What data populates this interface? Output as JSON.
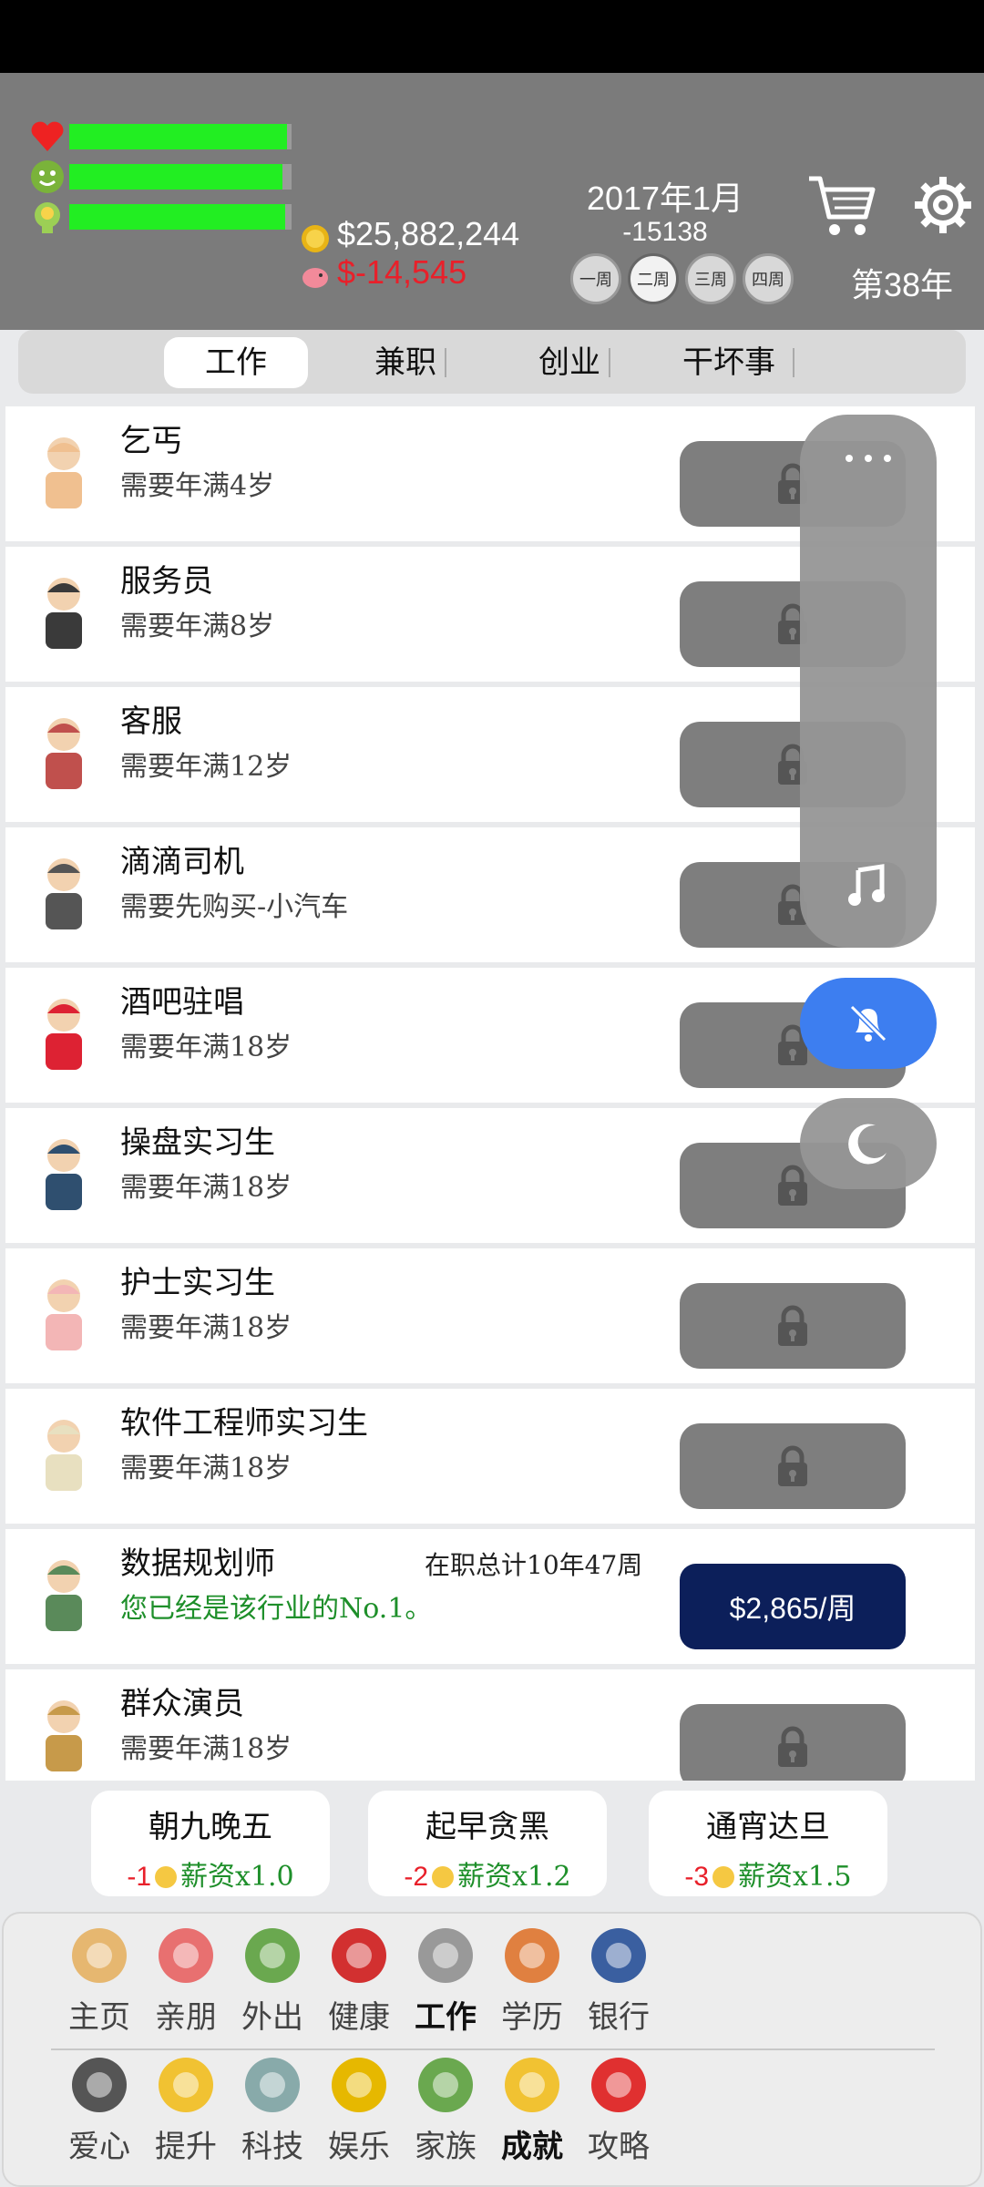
{
  "stats": {
    "health_level": 0.98,
    "mood_level": 0.96,
    "smart_level": 0.97,
    "cash": "$25,882,244",
    "debt": "$-14,545"
  },
  "calendar": {
    "date": "2017年1月",
    "day_number": "-15138",
    "weeks": [
      "一周",
      "二周",
      "三周",
      "四周"
    ],
    "active_week": 1,
    "year_label": "第38年"
  },
  "tabs": [
    "工作",
    "兼职",
    "创业",
    "干坏事"
  ],
  "jobs": [
    {
      "title": "乞丐",
      "req": "需要年满4岁",
      "locked": true
    },
    {
      "title": "服务员",
      "req": "需要年满8岁",
      "locked": true
    },
    {
      "title": "客服",
      "req": "需要年满12岁",
      "locked": true
    },
    {
      "title": "滴滴司机",
      "req": "需要先购买-小汽车",
      "locked": true
    },
    {
      "title": "酒吧驻唱",
      "req": "需要年满18岁",
      "locked": true
    },
    {
      "title": "操盘实习生",
      "req": "需要年满18岁",
      "locked": true
    },
    {
      "title": "护士实习生",
      "req": "需要年满18岁",
      "locked": true
    },
    {
      "title": "软件工程师实习生",
      "req": "需要年满18岁",
      "locked": true
    },
    {
      "title": "数据规划师",
      "req": "您已经是该行业的No.1。",
      "total": "在职总计10年47周",
      "pay": "$2,865/周",
      "locked": false
    },
    {
      "title": "群众演员",
      "req": "需要年满18岁",
      "locked": true
    }
  ],
  "modes": [
    {
      "title": "朝九晚五",
      "mood": "-1",
      "salary": "薪资x1.0"
    },
    {
      "title": "起早贪黑",
      "mood": "-2",
      "salary": "薪资x1.2"
    },
    {
      "title": "通宵达旦",
      "mood": "-3",
      "salary": "薪资x1.5"
    }
  ],
  "nav_row1": [
    "主页",
    "亲朋",
    "外出",
    "健康",
    "工作",
    "学历",
    "银行"
  ],
  "nav_row2": [
    "爱心",
    "提升",
    "科技",
    "娱乐",
    "家族",
    "成就",
    "攻略"
  ],
  "colors": {
    "accent_blue": "#3d7ef0",
    "pay_button": "#0c1f5a",
    "bar_green": "#22ee22",
    "debt_red": "#e8202a"
  }
}
